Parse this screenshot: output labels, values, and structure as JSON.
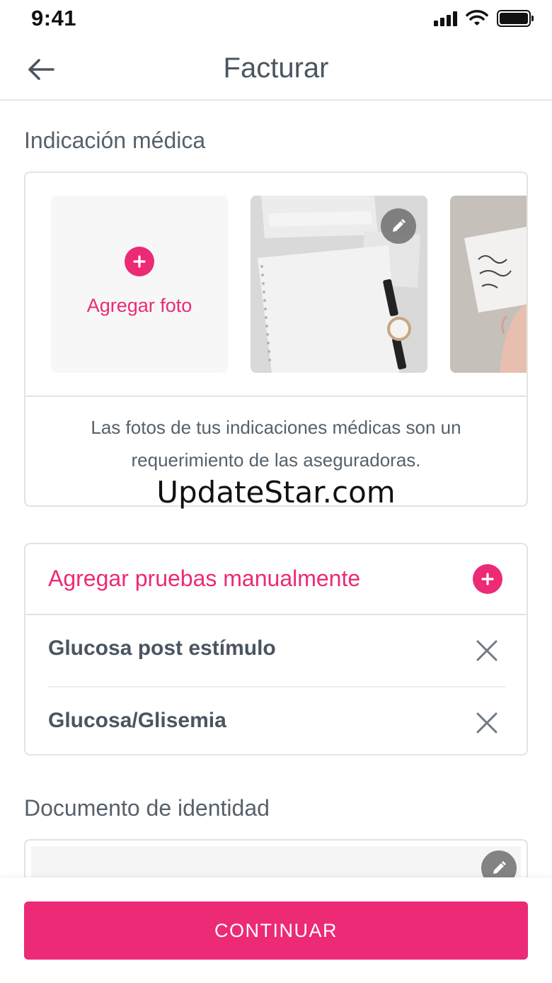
{
  "status_bar": {
    "time": "9:41"
  },
  "header": {
    "title": "Facturar"
  },
  "medical_indication": {
    "label": "Indicación médica",
    "add_photo_label": "Agregar foto",
    "note": "Las fotos de tus indicaciones médicas son un requerimiento de las aseguradoras."
  },
  "watermark": "UpdateStar.com",
  "tests": {
    "add_label": "Agregar pruebas manualmente",
    "items": [
      {
        "label": "Glucosa post estímulo"
      },
      {
        "label": "Glucosa/Glisemia"
      }
    ]
  },
  "identity_document": {
    "label": "Documento de identidad"
  },
  "continue_button": {
    "label": "CONTINUAR"
  },
  "colors": {
    "accent": "#ec2a76",
    "text": "#4a5560"
  }
}
